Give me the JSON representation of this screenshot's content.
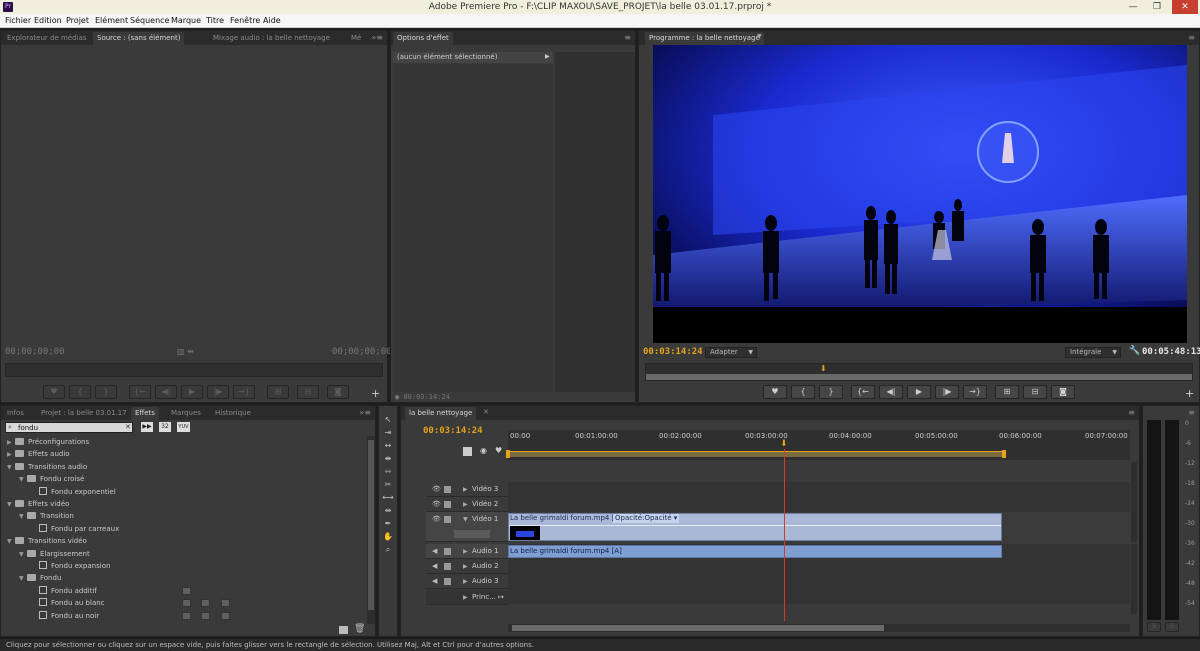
{
  "window": {
    "title": "Adobe Premiere Pro - F:\\CLIP MAXOU\\SAVE_PROJET\\la belle 03.01.17.prproj *",
    "app_icon": "Pr",
    "min": "—",
    "max": "❐",
    "close": "✕"
  },
  "menu": [
    "Fichier",
    "Edition",
    "Projet",
    "Elément",
    "Séquence",
    "Marque",
    "Titre",
    "Fenêtre",
    "Aide"
  ],
  "source_panel": {
    "tabs": [
      "Explorateur de médias",
      "Source : (sans élément)",
      "Mixage audio : la belle nettoyage",
      "Mé"
    ],
    "timecode_left": "00;00;00;00",
    "timecode_right": "00;00;00;00"
  },
  "effect_options": {
    "tab": "Options d'effet",
    "header": "(aucun élément sélectionné)",
    "timecode": "00:03:14:24"
  },
  "program_panel": {
    "tab": "Programme : la belle nettoyage",
    "timecode": "00:03:14:24",
    "zoom": "Adapter",
    "quality": "Intégrale",
    "duration": "00:05:48:13"
  },
  "effects_panel": {
    "tabs": [
      "Infos",
      "Projet : la belle 03.01.17",
      "Effets",
      "Marques",
      "Historique"
    ],
    "search_value": "fondu",
    "badges": [
      "32",
      "YUV"
    ],
    "tree": [
      {
        "label": "Préconfigurations",
        "level": 0,
        "kind": "folder",
        "open": false
      },
      {
        "label": "Effets audio",
        "level": 0,
        "kind": "folder",
        "open": false
      },
      {
        "label": "Transitions audio",
        "level": 0,
        "kind": "folder",
        "open": true
      },
      {
        "label": "Fondu croisé",
        "level": 1,
        "kind": "folder",
        "open": true
      },
      {
        "label": "Fondu exponentiel",
        "level": 2,
        "kind": "effect"
      },
      {
        "label": "Effets vidéo",
        "level": 0,
        "kind": "folder",
        "open": true
      },
      {
        "label": "Transition",
        "level": 1,
        "kind": "folder",
        "open": true
      },
      {
        "label": "Fondu par carreaux",
        "level": 2,
        "kind": "effect"
      },
      {
        "label": "Transitions vidéo",
        "level": 0,
        "kind": "folder",
        "open": true
      },
      {
        "label": "Elargissement",
        "level": 1,
        "kind": "folder",
        "open": true
      },
      {
        "label": "Fondu expansion",
        "level": 2,
        "kind": "effect"
      },
      {
        "label": "Fondu",
        "level": 1,
        "kind": "folder",
        "open": true
      },
      {
        "label": "Fondu additif",
        "level": 2,
        "kind": "effect"
      },
      {
        "label": "Fondu au blanc",
        "level": 2,
        "kind": "effect"
      },
      {
        "label": "Fondu au noir",
        "level": 2,
        "kind": "effect"
      }
    ]
  },
  "timeline": {
    "tab": "la belle nettoyage",
    "timecode": "00:03:14:24",
    "ruler": [
      "00:00",
      "00:01:00:00",
      "00:02:00:00",
      "00:03:00:00",
      "00:04:00:00",
      "00:05:00:00",
      "00:06:00:00",
      "00:07:00:00"
    ],
    "tracks": {
      "video3": "Vidéo 3",
      "video2": "Vidéo 2",
      "video1": "Vidéo 1",
      "audio1": "Audio 1",
      "audio2": "Audio 2",
      "audio3": "Audio 3",
      "master": "Princ..."
    },
    "video_clip": "La belle grimaldi forum.mp4 [V]",
    "opacity_menu": "Opacité:Opacité",
    "audio_clip": "La belle grimaldi forum.mp4 [A]",
    "playhead_fraction": 0.534
  },
  "audio_meter": {
    "scale": [
      "0",
      "-6",
      "-12",
      "-18",
      "-24",
      "-30",
      "-36",
      "-42",
      "-48",
      "-54"
    ],
    "solo_left": "S",
    "solo_right": "S"
  },
  "status_bar": "Cliquez pour sélectionner ou cliquez sur un espace vide, puis faites glisser vers le rectangle de sélection. Utilisez Maj, Alt et Ctrl pour d'autres options."
}
